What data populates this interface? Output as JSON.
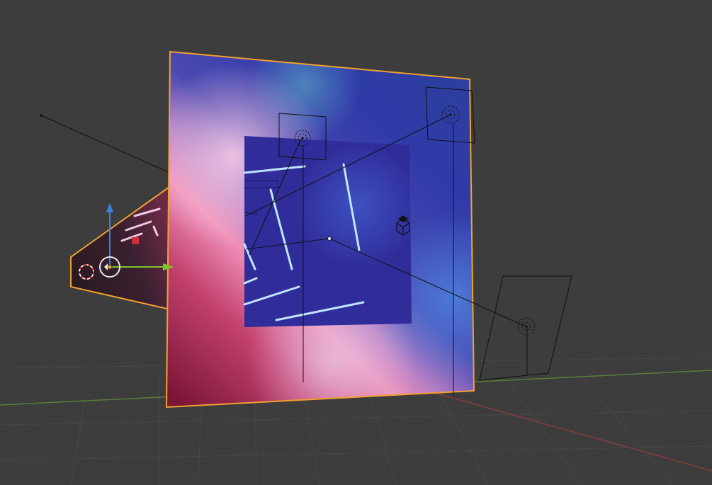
{
  "viewport": {
    "background": "#3d3d3d",
    "grid_color": "#474747",
    "x_axis_color": "#8a3a3a",
    "y_axis_color": "#5a7d3a",
    "selection_outline": "#f0a030"
  },
  "scene": {
    "selected_object": "plane",
    "plane_gradient": [
      "#8a1a3a",
      "#e0588a",
      "#f3b4d2",
      "#3c3ca8",
      "#3b4fb8",
      "#5a8ad8"
    ],
    "render_square_color": "#332c9e",
    "neon_color": "#b7e3ff"
  },
  "gizmo": {
    "z_axis_color": "#3a80e0",
    "y_axis_color": "#7bc52a",
    "origin_color": "#f0a030"
  },
  "icons": [
    "camera-object-icon",
    "light-object-icon",
    "point-light-icon",
    "empty-cube-icon",
    "3d-cursor-icon"
  ]
}
